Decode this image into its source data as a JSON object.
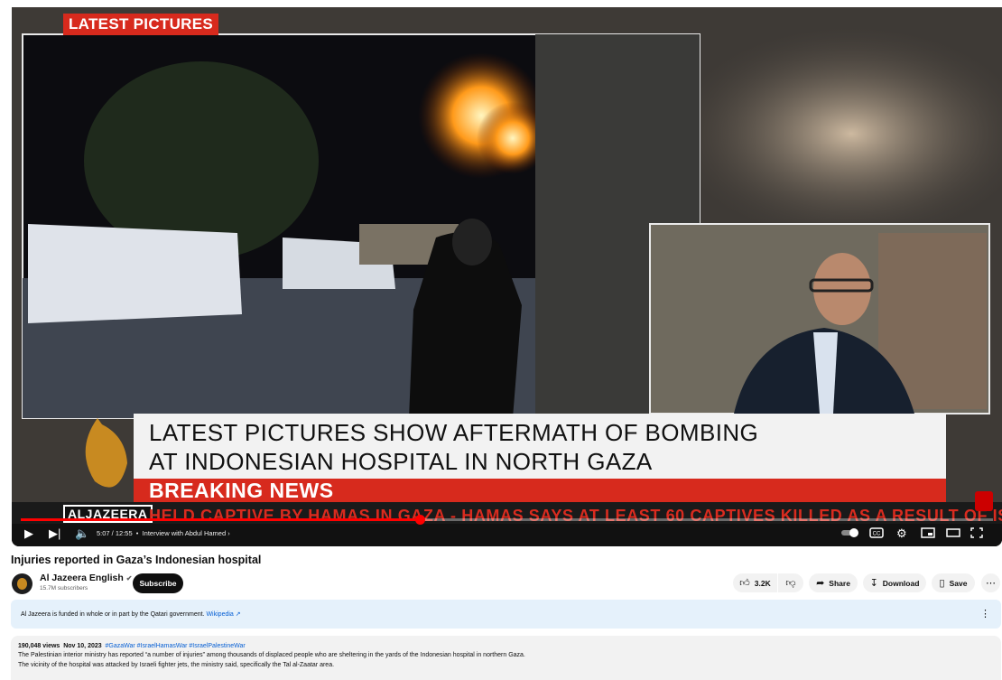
{
  "video": {
    "tag_latest": "LATEST PICTURES",
    "headline_line1": "LATEST PICTURES SHOW AFTERMATH OF BOMBING",
    "headline_line2": "AT INDONESIAN HOSPITAL IN NORTH GAZA",
    "breaking": "BREAKING NEWS",
    "channel_label": "ALJAZEERA",
    "ticker": "HELD CAPTIVE BY HAMAS IN GAZA  -  HAMAS SAYS AT LEAST 60 CAPTIVES KILLED AS A RESULT OF ISRAE",
    "progress_fraction": 0.41
  },
  "controls": {
    "time": "5:07 / 12:55",
    "chapter": "Interview with Abdul Hamed",
    "icons": [
      "play-icon",
      "next-icon",
      "volume-icon",
      "autoplay-toggle",
      "captions-icon",
      "settings-icon",
      "miniplayer-icon",
      "theater-icon",
      "fullscreen-icon"
    ],
    "cc_label": "CC"
  },
  "page": {
    "title": "Injuries reported in Gaza’s Indonesian hospital",
    "channel_name": "Al Jazeera English",
    "subscribers": "15.7M subscribers",
    "subscribe": "Subscribe",
    "likes": "3.2K",
    "share": "Share",
    "download": "Download",
    "save": "Save"
  },
  "notice": {
    "text": "Al Jazeera is funded in whole or in part by the Qatari government.",
    "link": "Wikipedia"
  },
  "description": {
    "views": "190,048 views",
    "date": "Nov 10, 2023",
    "hashtags": "#GazaWar #IsraelHamasWar #IsraelPalestineWar",
    "line1": "The Palestinian interior ministry has reported “a number of injuries” among thousands of displaced people who are sheltering in the yards of the Indonesian hospital in northern Gaza.",
    "line2": "The vicinity of the hospital was attacked by Israeli fighter jets, the ministry said, specifically the Tal al-Zaatar area."
  },
  "colors": {
    "accent_red": "#d72a1d",
    "link_blue": "#065fd4",
    "notice_bg": "#e5f1fb"
  }
}
